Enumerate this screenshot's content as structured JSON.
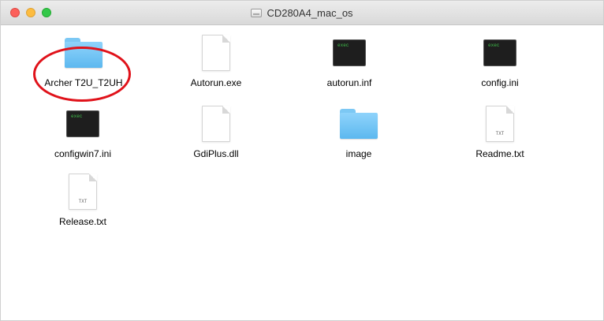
{
  "window": {
    "title": "CD280A4_mac_os",
    "controls": [
      "close",
      "minimize",
      "zoom"
    ]
  },
  "files": [
    {
      "name": "Archer T2U_T2UH",
      "type": "folder",
      "icon": "folder-icon"
    },
    {
      "name": "Autorun.exe",
      "type": "document",
      "icon": "document-icon",
      "badge": ""
    },
    {
      "name": "autorun.inf",
      "type": "exec",
      "icon": "terminal-icon",
      "badge": "exec"
    },
    {
      "name": "config.ini",
      "type": "exec",
      "icon": "terminal-icon",
      "badge": "exec"
    },
    {
      "name": "configwin7.ini",
      "type": "exec",
      "icon": "terminal-icon",
      "badge": "exec"
    },
    {
      "name": "GdiPlus.dll",
      "type": "document",
      "icon": "document-icon",
      "badge": ""
    },
    {
      "name": "image",
      "type": "folder",
      "icon": "folder-icon"
    },
    {
      "name": "Readme.txt",
      "type": "document",
      "icon": "text-document-icon",
      "badge": "TXT"
    },
    {
      "name": "Release.txt",
      "type": "document",
      "icon": "text-document-icon",
      "badge": "TXT"
    }
  ],
  "annotation": {
    "color": "#e0121a",
    "target": "Archer T2U_T2UH"
  }
}
